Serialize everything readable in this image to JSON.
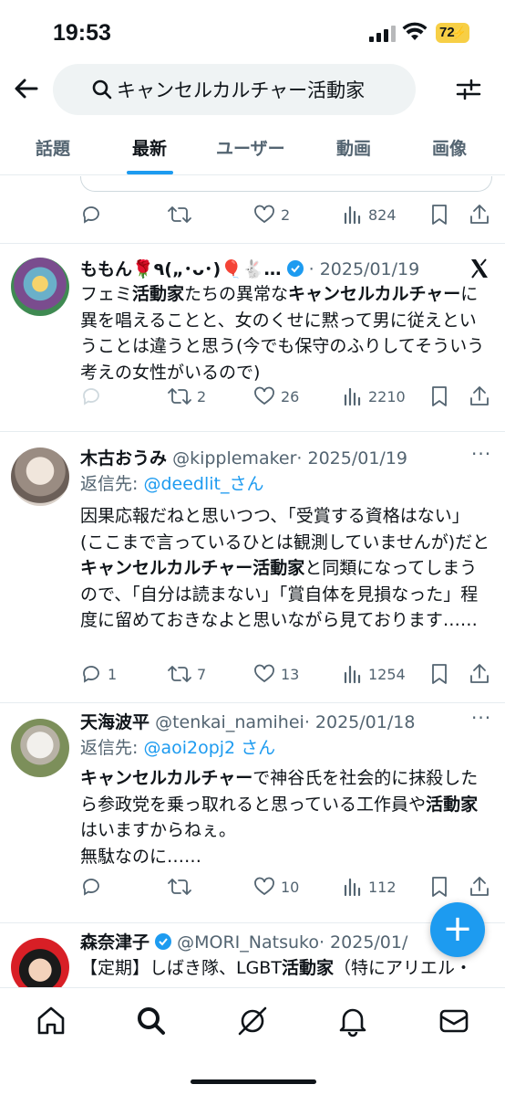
{
  "status": {
    "time": "19:53",
    "battery": "72"
  },
  "search": {
    "query": "キャンセルカルチャー活動家"
  },
  "tabs": [
    "話題",
    "最新",
    "ユーザー",
    "動画",
    "画像"
  ],
  "active_tab": "最新",
  "top_actions": {
    "likes": "2",
    "views": "824"
  },
  "posts": [
    {
      "name": "ももん🌹٩(„･ᴗ･)🎈🐇…",
      "date": "· 2025/01/19",
      "text": [
        {
          "t": "フェミ"
        },
        {
          "t": "活動家",
          "b": true
        },
        {
          "t": "たちの異常な"
        },
        {
          "t": "キャンセルカルチャー",
          "b": true
        },
        {
          "t": "に異を唱えることと、女のくせに黙って男に従えということは違うと思う(今でも保守のふりしてそういう考えの女性がいるので)"
        }
      ],
      "replies": "",
      "reposts": "2",
      "likes": "26",
      "views": "2210"
    },
    {
      "name": "木古おうみ",
      "handle": "@kipplemaker",
      "date": "· 2025/01/19",
      "reply_prefix": "返信先: ",
      "reply_to": "@deedlit_さん",
      "text": [
        {
          "t": "因果応報だねと思いつつ、「受賞する資格はない」(ここまで言っているひとは観測していませんが)だと"
        },
        {
          "t": "キャンセルカルチャー活動家",
          "b": true
        },
        {
          "t": "と同類になってしまうので、「自分は読まない」「賞自体を見損なった」程度に留めておきなよと思いながら見ております……"
        }
      ],
      "replies": "1",
      "reposts": "7",
      "likes": "13",
      "views": "1254"
    },
    {
      "name": "天海波平",
      "handle": "@tenkai_namihei",
      "date": "· 2025/01/18",
      "reply_prefix": "返信先: ",
      "reply_to": "@aoi2opj2 さん",
      "text": [
        {
          "t": "キャンセルカルチャー",
          "b": true
        },
        {
          "t": "で神谷氏を社会的に抹殺したら参政党を乗っ取れると思っている工作員や"
        },
        {
          "t": "活動家",
          "b": true
        },
        {
          "t": "はいますからねぇ。\n無駄なのに……"
        }
      ],
      "replies": "",
      "reposts": "",
      "likes": "10",
      "views": "112"
    },
    {
      "name": "森奈津子",
      "handle": "@MORI_Natsuko",
      "date": "· 2025/01/",
      "text": [
        {
          "t": "【定期】しばき隊、LGBT"
        },
        {
          "t": "活動家",
          "b": true
        },
        {
          "t": "（特にアリエル・"
        }
      ]
    }
  ],
  "colors": {
    "accent": "#1d9bf0",
    "text": "#0f1419",
    "muted": "#536471",
    "battery": "#f7cf46"
  }
}
